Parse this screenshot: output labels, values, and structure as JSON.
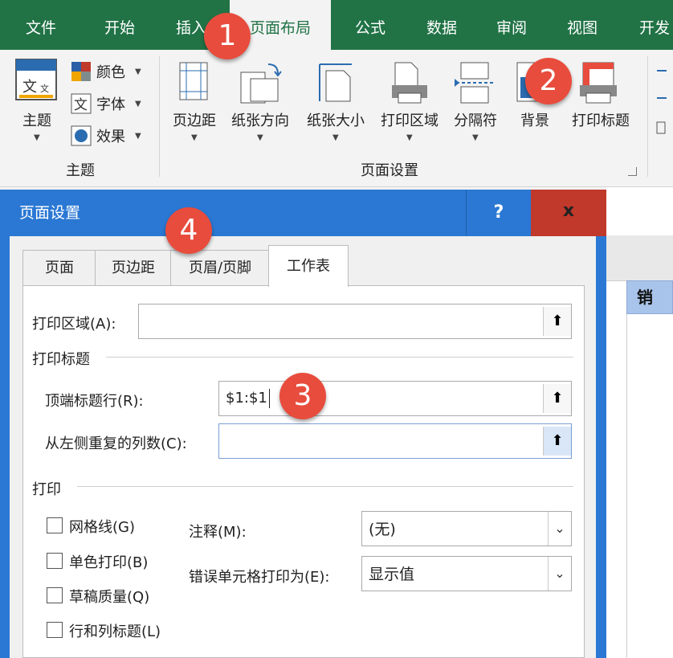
{
  "ribbon": {
    "tabs": [
      "文件",
      "开始",
      "插入",
      "页面布局",
      "公式",
      "数据",
      "审阅",
      "视图",
      "开发"
    ],
    "theme_group": {
      "theme_label": "主题",
      "colors_label": "颜色",
      "fonts_label": "字体",
      "effects_label": "效果",
      "group_label": "主题"
    },
    "page_setup_group": {
      "margins": "页边距",
      "orientation": "纸张方向",
      "size": "纸张大小",
      "print_area": "打印区域",
      "breaks": "分隔符",
      "background": "背景",
      "print_titles": "打印标题",
      "group_label": "页面设置"
    }
  },
  "badges": [
    "1",
    "2",
    "3",
    "4"
  ],
  "dialog": {
    "title": "页面设置",
    "help": "?",
    "close": "x",
    "tabs": [
      "页面",
      "页边距",
      "页眉/页脚",
      "工作表"
    ],
    "print_area_label": "打印区域(A):",
    "print_area_value": "",
    "print_titles_section": "打印标题",
    "rows_repeat_label": "顶端标题行(R):",
    "rows_repeat_value": "$1:$1",
    "cols_repeat_label": "从左侧重复的列数(C):",
    "cols_repeat_value": "",
    "print_section": "打印",
    "gridlines": "网格线(G)",
    "black_white": "单色打印(B)",
    "draft": "草稿质量(Q)",
    "row_col_headings": "行和列标题(L)",
    "comments_label": "注释(M):",
    "comments_value": "(无)",
    "errors_label": "错误单元格打印为(E):",
    "errors_value": "显示值"
  },
  "sheet": {
    "header_cell": "销"
  },
  "colors": {
    "ribbon_green": "#217346",
    "dialog_blue": "#2b78d4",
    "badge_red": "#e84c3d"
  }
}
